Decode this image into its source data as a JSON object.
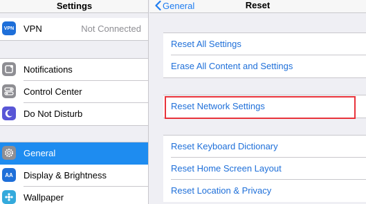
{
  "left": {
    "title": "Settings",
    "vpn": {
      "label": "VPN",
      "icon_text": "VPN",
      "value": "Not Connected",
      "icon_color": "#1e6fd9"
    },
    "group2": [
      {
        "label": "Notifications",
        "icon": "notifications-icon",
        "icon_color": "#8e8e93"
      },
      {
        "label": "Control Center",
        "icon": "control-center-icon",
        "icon_color": "#8e8e93"
      },
      {
        "label": "Do Not Disturb",
        "icon": "moon-icon",
        "icon_color": "#5856d6"
      }
    ],
    "group3": [
      {
        "label": "General",
        "icon": "gear-icon",
        "icon_color": "#8e8e93",
        "selected": true
      },
      {
        "label": "Display & Brightness",
        "icon": "display-icon",
        "icon_text": "AA",
        "icon_color": "#1e6fd9"
      },
      {
        "label": "Wallpaper",
        "icon": "wallpaper-icon",
        "icon_color": "#34aadc"
      }
    ]
  },
  "right": {
    "back_label": "General",
    "title": "Reset",
    "group1": [
      "Reset All Settings",
      "Erase All Content and Settings"
    ],
    "group2": [
      "Reset Network Settings"
    ],
    "group3": [
      "Reset Keyboard Dictionary",
      "Reset Home Screen Layout",
      "Reset Location & Privacy"
    ]
  },
  "colors": {
    "accent": "#1e6fd9",
    "selected": "#1e8cf0",
    "highlight_box": "#e8323a"
  }
}
